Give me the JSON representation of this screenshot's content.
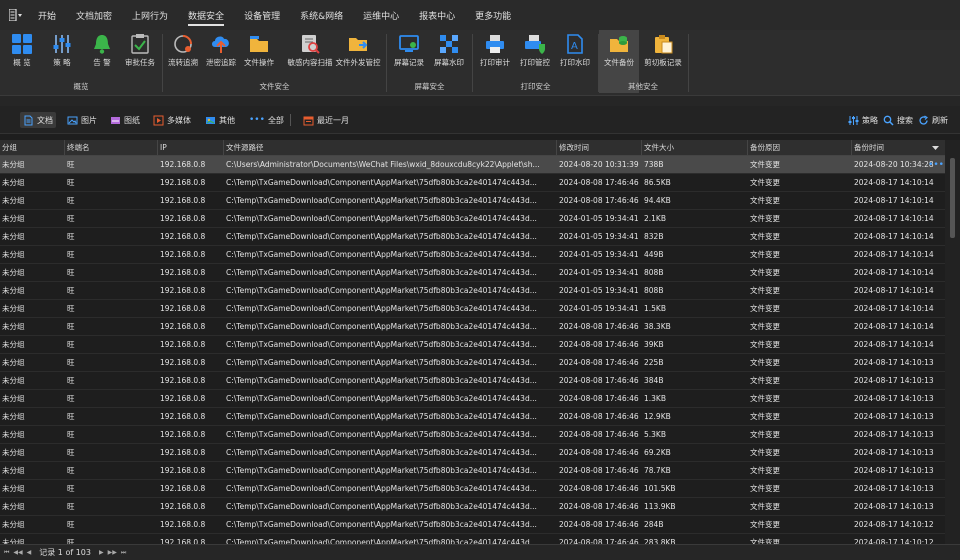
{
  "menubar": {
    "tabs": [
      "开始",
      "文档加密",
      "上网行为",
      "数据安全",
      "设备管理",
      "系统&网络",
      "运维中心",
      "报表中心",
      "更多功能"
    ],
    "active_tab": "数据安全"
  },
  "ribbon": {
    "buttons": [
      {
        "label": "概  览",
        "icon": "overview-grid-icon"
      },
      {
        "label": "策  略",
        "icon": "policy-sliders-icon"
      },
      {
        "label": "告  警",
        "icon": "alarm-bell-icon"
      },
      {
        "label": "审批任务",
        "icon": "approval-check-icon"
      },
      {
        "label": "流转追溯",
        "icon": "trace-cycle-icon"
      },
      {
        "label": "泄密追踪",
        "icon": "leak-cloud-upload-icon"
      },
      {
        "label": "文件操作",
        "icon": "file-folder-icon"
      },
      {
        "label": "敏感内容扫描",
        "icon": "sensitive-scan-icon"
      },
      {
        "label": "文件外发管控",
        "icon": "outbound-folder-icon"
      },
      {
        "label": "屏幕记录",
        "icon": "screen-record-icon"
      },
      {
        "label": "屏幕水印",
        "icon": "screen-watermark-icon"
      },
      {
        "label": "打印审计",
        "icon": "print-audit-icon"
      },
      {
        "label": "打印管控",
        "icon": "print-control-icon"
      },
      {
        "label": "打印水印",
        "icon": "print-watermark-icon"
      },
      {
        "label": "文件备份",
        "icon": "file-backup-icon"
      },
      {
        "label": "剪切板记录",
        "icon": "clipboard-record-icon"
      }
    ],
    "groups": [
      "概览",
      "文件安全",
      "屏幕安全",
      "打印安全",
      "其他安全"
    ]
  },
  "filterbar": {
    "types": [
      "文档",
      "图片",
      "图纸",
      "多媒体",
      "其他",
      "全部"
    ],
    "range": "最近一月",
    "actions": [
      "策略",
      "搜索",
      "刷新"
    ]
  },
  "table": {
    "columns": [
      "分组",
      "终端名",
      "IP",
      "文件源路径",
      "修改时间",
      "文件大小",
      "备份原因",
      "备份时间"
    ],
    "rows": [
      [
        "未分组",
        "旺",
        "192.168.0.8",
        "C:\\Users\\Administrator\\Documents\\WeChat Files\\wxid_8douxcdu8cyk22\\Applet\\sh...",
        "2024-08-20 10:31:39",
        "738B",
        "文件变更",
        "2024-08-20 10:34:28"
      ],
      [
        "未分组",
        "旺",
        "192.168.0.8",
        "C:\\Temp\\TxGameDownload\\Component\\AppMarket\\75dfb80b3ca2e401474c443d...",
        "2024-08-08 17:46:46",
        "86.5KB",
        "文件变更",
        "2024-08-17 14:10:14"
      ],
      [
        "未分组",
        "旺",
        "192.168.0.8",
        "C:\\Temp\\TxGameDownload\\Component\\AppMarket\\75dfb80b3ca2e401474c443d...",
        "2024-08-08 17:46:46",
        "94.4KB",
        "文件变更",
        "2024-08-17 14:10:14"
      ],
      [
        "未分组",
        "旺",
        "192.168.0.8",
        "C:\\Temp\\TxGameDownload\\Component\\AppMarket\\75dfb80b3ca2e401474c443d...",
        "2024-01-05 19:34:41",
        "2.1KB",
        "文件变更",
        "2024-08-17 14:10:14"
      ],
      [
        "未分组",
        "旺",
        "192.168.0.8",
        "C:\\Temp\\TxGameDownload\\Component\\AppMarket\\75dfb80b3ca2e401474c443d...",
        "2024-01-05 19:34:41",
        "832B",
        "文件变更",
        "2024-08-17 14:10:14"
      ],
      [
        "未分组",
        "旺",
        "192.168.0.8",
        "C:\\Temp\\TxGameDownload\\Component\\AppMarket\\75dfb80b3ca2e401474c443d...",
        "2024-01-05 19:34:41",
        "449B",
        "文件变更",
        "2024-08-17 14:10:14"
      ],
      [
        "未分组",
        "旺",
        "192.168.0.8",
        "C:\\Temp\\TxGameDownload\\Component\\AppMarket\\75dfb80b3ca2e401474c443d...",
        "2024-01-05 19:34:41",
        "808B",
        "文件变更",
        "2024-08-17 14:10:14"
      ],
      [
        "未分组",
        "旺",
        "192.168.0.8",
        "C:\\Temp\\TxGameDownload\\Component\\AppMarket\\75dfb80b3ca2e401474c443d...",
        "2024-01-05 19:34:41",
        "808B",
        "文件变更",
        "2024-08-17 14:10:14"
      ],
      [
        "未分组",
        "旺",
        "192.168.0.8",
        "C:\\Temp\\TxGameDownload\\Component\\AppMarket\\75dfb80b3ca2e401474c443d...",
        "2024-01-05 19:34:41",
        "1.5KB",
        "文件变更",
        "2024-08-17 14:10:14"
      ],
      [
        "未分组",
        "旺",
        "192.168.0.8",
        "C:\\Temp\\TxGameDownload\\Component\\AppMarket\\75dfb80b3ca2e401474c443d...",
        "2024-08-08 17:46:46",
        "38.3KB",
        "文件变更",
        "2024-08-17 14:10:14"
      ],
      [
        "未分组",
        "旺",
        "192.168.0.8",
        "C:\\Temp\\TxGameDownload\\Component\\AppMarket\\75dfb80b3ca2e401474c443d...",
        "2024-08-08 17:46:46",
        "39KB",
        "文件变更",
        "2024-08-17 14:10:14"
      ],
      [
        "未分组",
        "旺",
        "192.168.0.8",
        "C:\\Temp\\TxGameDownload\\Component\\AppMarket\\75dfb80b3ca2e401474c443d...",
        "2024-08-08 17:46:46",
        "225B",
        "文件变更",
        "2024-08-17 14:10:13"
      ],
      [
        "未分组",
        "旺",
        "192.168.0.8",
        "C:\\Temp\\TxGameDownload\\Component\\AppMarket\\75dfb80b3ca2e401474c443d...",
        "2024-08-08 17:46:46",
        "384B",
        "文件变更",
        "2024-08-17 14:10:13"
      ],
      [
        "未分组",
        "旺",
        "192.168.0.8",
        "C:\\Temp\\TxGameDownload\\Component\\AppMarket\\75dfb80b3ca2e401474c443d...",
        "2024-08-08 17:46:46",
        "1.3KB",
        "文件变更",
        "2024-08-17 14:10:13"
      ],
      [
        "未分组",
        "旺",
        "192.168.0.8",
        "C:\\Temp\\TxGameDownload\\Component\\AppMarket\\75dfb80b3ca2e401474c443d...",
        "2024-08-08 17:46:46",
        "12.9KB",
        "文件变更",
        "2024-08-17 14:10:13"
      ],
      [
        "未分组",
        "旺",
        "192.168.0.8",
        "C:\\Temp\\TxGameDownload\\Component\\AppMarket\\75dfb80b3ca2e401474c443d...",
        "2024-08-08 17:46:46",
        "5.3KB",
        "文件变更",
        "2024-08-17 14:10:13"
      ],
      [
        "未分组",
        "旺",
        "192.168.0.8",
        "C:\\Temp\\TxGameDownload\\Component\\AppMarket\\75dfb80b3ca2e401474c443d...",
        "2024-08-08 17:46:46",
        "69.2KB",
        "文件变更",
        "2024-08-17 14:10:13"
      ],
      [
        "未分组",
        "旺",
        "192.168.0.8",
        "C:\\Temp\\TxGameDownload\\Component\\AppMarket\\75dfb80b3ca2e401474c443d...",
        "2024-08-08 17:46:46",
        "78.7KB",
        "文件变更",
        "2024-08-17 14:10:13"
      ],
      [
        "未分组",
        "旺",
        "192.168.0.8",
        "C:\\Temp\\TxGameDownload\\Component\\AppMarket\\75dfb80b3ca2e401474c443d...",
        "2024-08-08 17:46:46",
        "101.5KB",
        "文件变更",
        "2024-08-17 14:10:13"
      ],
      [
        "未分组",
        "旺",
        "192.168.0.8",
        "C:\\Temp\\TxGameDownload\\Component\\AppMarket\\75dfb80b3ca2e401474c443d...",
        "2024-08-08 17:46:46",
        "113.9KB",
        "文件变更",
        "2024-08-17 14:10:13"
      ],
      [
        "未分组",
        "旺",
        "192.168.0.8",
        "C:\\Temp\\TxGameDownload\\Component\\AppMarket\\75dfb80b3ca2e401474c443d...",
        "2024-08-08 17:46:46",
        "284B",
        "文件变更",
        "2024-08-17 14:10:12"
      ],
      [
        "未分组",
        "旺",
        "192.168.0.8",
        "C:\\Temp\\TxGameDownload\\Component\\AppMarket\\75dfb80b3ca2e401474c443d...",
        "2024-08-08 17:46:46",
        "283.8KB",
        "文件变更",
        "2024-08-17 14:10:12"
      ]
    ]
  },
  "statusbar": {
    "record_text": "记录 1 of 103"
  },
  "colors": {
    "accent_blue": "#2f8cf0",
    "bell_green": "#3bb54a",
    "folder_yellow": "#f0b43c",
    "dots_blue": "#4aa3ff"
  }
}
